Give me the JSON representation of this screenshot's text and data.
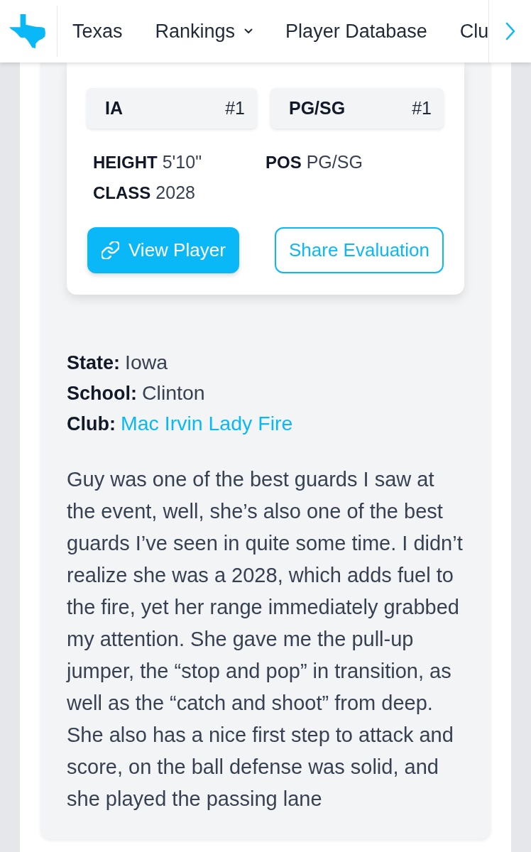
{
  "nav": {
    "items": [
      {
        "label": "Texas",
        "kind": "link"
      },
      {
        "label": "Rankings",
        "kind": "dropdown"
      },
      {
        "label": "Player Database",
        "kind": "link"
      },
      {
        "label": "Clu",
        "kind": "link"
      }
    ]
  },
  "card": {
    "ranks": [
      {
        "label": "IA",
        "value": "#1"
      },
      {
        "label": "PG/SG",
        "value": "#1"
      }
    ],
    "stats": [
      {
        "label": "HEIGHT",
        "value": "5'10\""
      },
      {
        "label": "POS",
        "value": "PG/SG"
      },
      {
        "label": "CLASS",
        "value": "2028"
      }
    ],
    "buttons": [
      {
        "label": "View Player",
        "kind": "primary"
      },
      {
        "label": "Share Evaluation",
        "kind": "outline"
      }
    ]
  },
  "details": [
    {
      "label": "State:",
      "value": "Iowa",
      "kind": "text"
    },
    {
      "label": "School:",
      "value": "Clinton",
      "kind": "text"
    },
    {
      "label": "Club:",
      "value": "Mac Irvin Lady Fire",
      "kind": "link"
    }
  ],
  "evaluation": "Guy was one of the best guards I saw at the event, well, she’s also one of the best guards I’ve seen in quite some time. I didn’t realize she was a 2028, which adds fuel to the fire, yet her range immediately grabbed my attention. She gave me the pull-up jumper, the “stop and pop” in transition, as well as the “catch and shoot” from deep. She also has a nice first step to attack and score, on the ball defense was solid, and she played the passing lane"
}
